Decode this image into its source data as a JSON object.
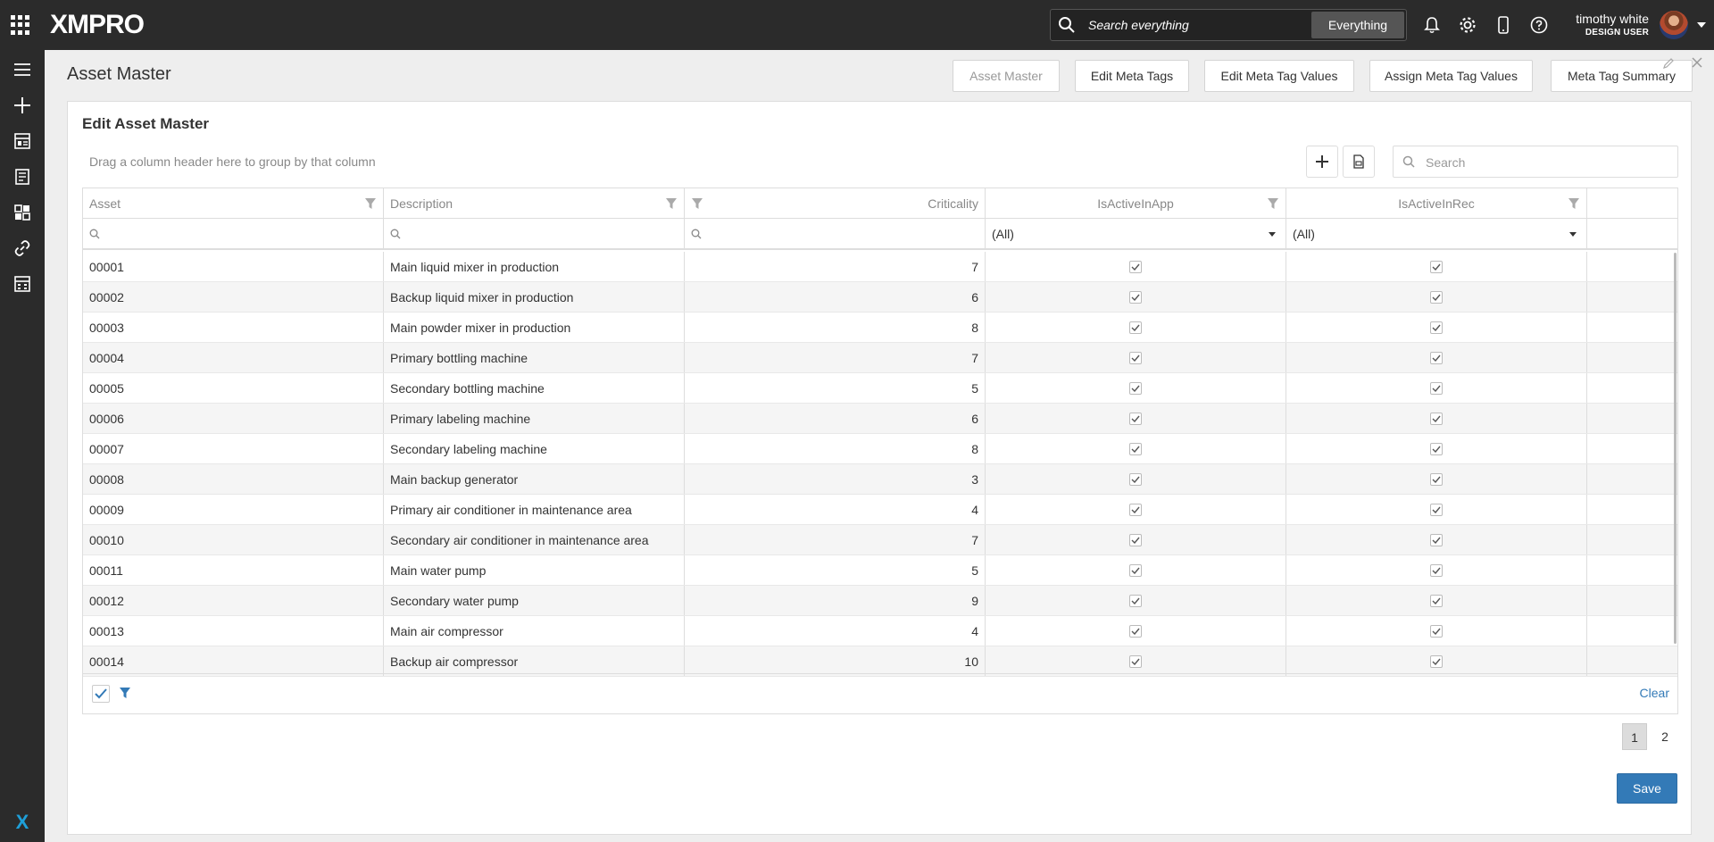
{
  "topbar": {
    "logo": "XMPRO",
    "search_placeholder": "Search everything",
    "search_scope": "Everything",
    "user_name": "timothy white",
    "user_role": "DESIGN USER"
  },
  "header": {
    "title": "Asset Master",
    "nav": [
      "Asset Master",
      "Edit Meta Tags",
      "Edit Meta Tag Values",
      "Assign Meta Tag Values",
      "Meta Tag Summary"
    ]
  },
  "panel": {
    "title": "Edit Asset Master",
    "group_hint": "Drag a column header here to group by that column",
    "search_placeholder": "Search"
  },
  "grid": {
    "columns": [
      "Asset",
      "Description",
      "Criticality",
      "IsActiveInApp",
      "IsActiveInRec"
    ],
    "filter_all": [
      "(All)",
      "(All)"
    ],
    "rows": [
      {
        "asset": "00001",
        "description": "Main liquid mixer in production",
        "criticality": "7",
        "app": true,
        "rec": true
      },
      {
        "asset": "00002",
        "description": "Backup liquid mixer in production",
        "criticality": "6",
        "app": true,
        "rec": true
      },
      {
        "asset": "00003",
        "description": "Main powder mixer in production",
        "criticality": "8",
        "app": true,
        "rec": true
      },
      {
        "asset": "00004",
        "description": "Primary bottling machine",
        "criticality": "7",
        "app": true,
        "rec": true
      },
      {
        "asset": "00005",
        "description": "Secondary bottling machine",
        "criticality": "5",
        "app": true,
        "rec": true
      },
      {
        "asset": "00006",
        "description": "Primary labeling machine",
        "criticality": "6",
        "app": true,
        "rec": true
      },
      {
        "asset": "00007",
        "description": "Secondary labeling machine",
        "criticality": "8",
        "app": true,
        "rec": true
      },
      {
        "asset": "00008",
        "description": "Main backup generator",
        "criticality": "3",
        "app": true,
        "rec": true
      },
      {
        "asset": "00009",
        "description": "Primary air conditioner in maintenance area",
        "criticality": "4",
        "app": true,
        "rec": true
      },
      {
        "asset": "00010",
        "description": "Secondary air conditioner in maintenance area",
        "criticality": "7",
        "app": true,
        "rec": true
      },
      {
        "asset": "00011",
        "description": "Main water pump",
        "criticality": "5",
        "app": true,
        "rec": true
      },
      {
        "asset": "00012",
        "description": "Secondary water pump",
        "criticality": "9",
        "app": true,
        "rec": true
      },
      {
        "asset": "00013",
        "description": "Main air compressor",
        "criticality": "4",
        "app": true,
        "rec": true
      },
      {
        "asset": "00014",
        "description": "Backup air compressor",
        "criticality": "10",
        "app": true,
        "rec": true
      }
    ],
    "footer_clear": "Clear"
  },
  "pager": {
    "pages": [
      "1",
      "2"
    ],
    "current": "1"
  },
  "actions": {
    "save": "Save"
  },
  "colors": {
    "topbar": "#2b2b2b",
    "accent": "#337ab7",
    "logo_x": "#1e9fd8"
  }
}
